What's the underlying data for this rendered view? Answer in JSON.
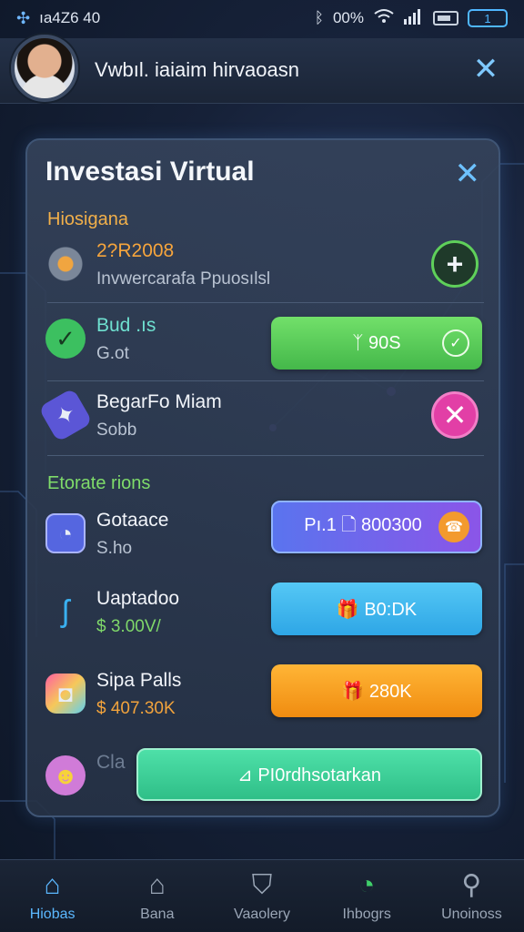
{
  "status_bar": {
    "left_icon": "pinwheel-icon",
    "time": "ıa4Z6 40",
    "bluetooth": "ᛒ",
    "battery_pct": "00%",
    "battery_box": "1"
  },
  "header": {
    "title": "Vwbıl. iaiaim hirvaoasn",
    "close": "✕"
  },
  "card": {
    "title": "Investasi Virtual",
    "close": "✕",
    "section1": "Hiosigana",
    "section2": "Etorate rions",
    "items": [
      {
        "icon": "gear-icon",
        "title": "2?R2008",
        "subtitle": "Invwercarafa Ppuosılsl",
        "action": "+"
      },
      {
        "icon": "chat-icon",
        "title": "Bud .ıs",
        "subtitle": "G.ot",
        "action": "ᛉ 90S",
        "action_icon": "check-icon"
      },
      {
        "icon": "ticket-icon",
        "title": "BegarFo Miam",
        "subtitle": "Sobb",
        "action": "✕"
      },
      {
        "icon": "frame-icon",
        "title": "Gotaace",
        "subtitle": "S.ho",
        "action": "Pı.1 🗋 800300",
        "action_icon": "phone-icon"
      },
      {
        "icon": "bolt-icon",
        "title": "Uaptadoo",
        "subtitle": "$ 3.00V/",
        "action": "🎁 B0:DK"
      },
      {
        "icon": "jar-icon",
        "title": "Sipa Palls",
        "subtitle": "$ 407.30K",
        "action": "🎁 280K"
      },
      {
        "icon": "face-icon",
        "title": "Cla",
        "subtitle": "",
        "action": "⊿ PI0rdhsotarkan"
      }
    ]
  },
  "nav": [
    {
      "label": "Hiobas",
      "icon": "home-icon",
      "active": true
    },
    {
      "label": "Bana",
      "icon": "house-icon",
      "active": false
    },
    {
      "label": "Vaaolery",
      "icon": "bag-icon",
      "active": false
    },
    {
      "label": "Ihbogrs",
      "icon": "gauge-icon",
      "active": false
    },
    {
      "label": "Unoinoss",
      "icon": "search-icon",
      "active": false
    }
  ],
  "colors": {
    "accent": "#5bb8ff",
    "green": "#5fd05a",
    "purple": "#8a5cf0",
    "blue": "#3fb8f0",
    "orange": "#f7a21c",
    "teal": "#3fd09a"
  }
}
